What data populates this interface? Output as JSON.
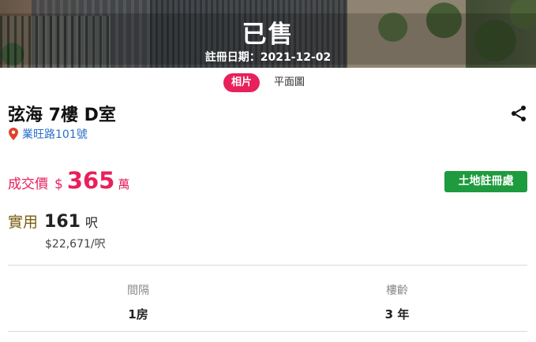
{
  "hero": {
    "status": "已售",
    "registration_date": "註冊日期：2021-12-02"
  },
  "tabs": [
    {
      "label": "相片",
      "active": true
    },
    {
      "label": "平面圖",
      "active": false
    }
  ],
  "listing": {
    "title": "弦海 7樓 D室",
    "address": "業旺路101號"
  },
  "price": {
    "label": "成交價",
    "currency": "$",
    "amount": "365",
    "unit": "萬"
  },
  "land_registry_button": "土地註冊處",
  "area": {
    "label": "實用",
    "value": "161",
    "unit": "呎",
    "price_per_ft": "$22,671/呎"
  },
  "stats": [
    {
      "label": "間隔",
      "value": "1房"
    },
    {
      "label": "樓齡",
      "value": "3 年"
    }
  ],
  "colors": {
    "accent": "#e8205c",
    "link": "#2a6fc9",
    "button": "#1e9b3e",
    "area_label": "#7a5d10"
  },
  "icons": {
    "share": "share-icon",
    "location": "map-pin-icon"
  }
}
